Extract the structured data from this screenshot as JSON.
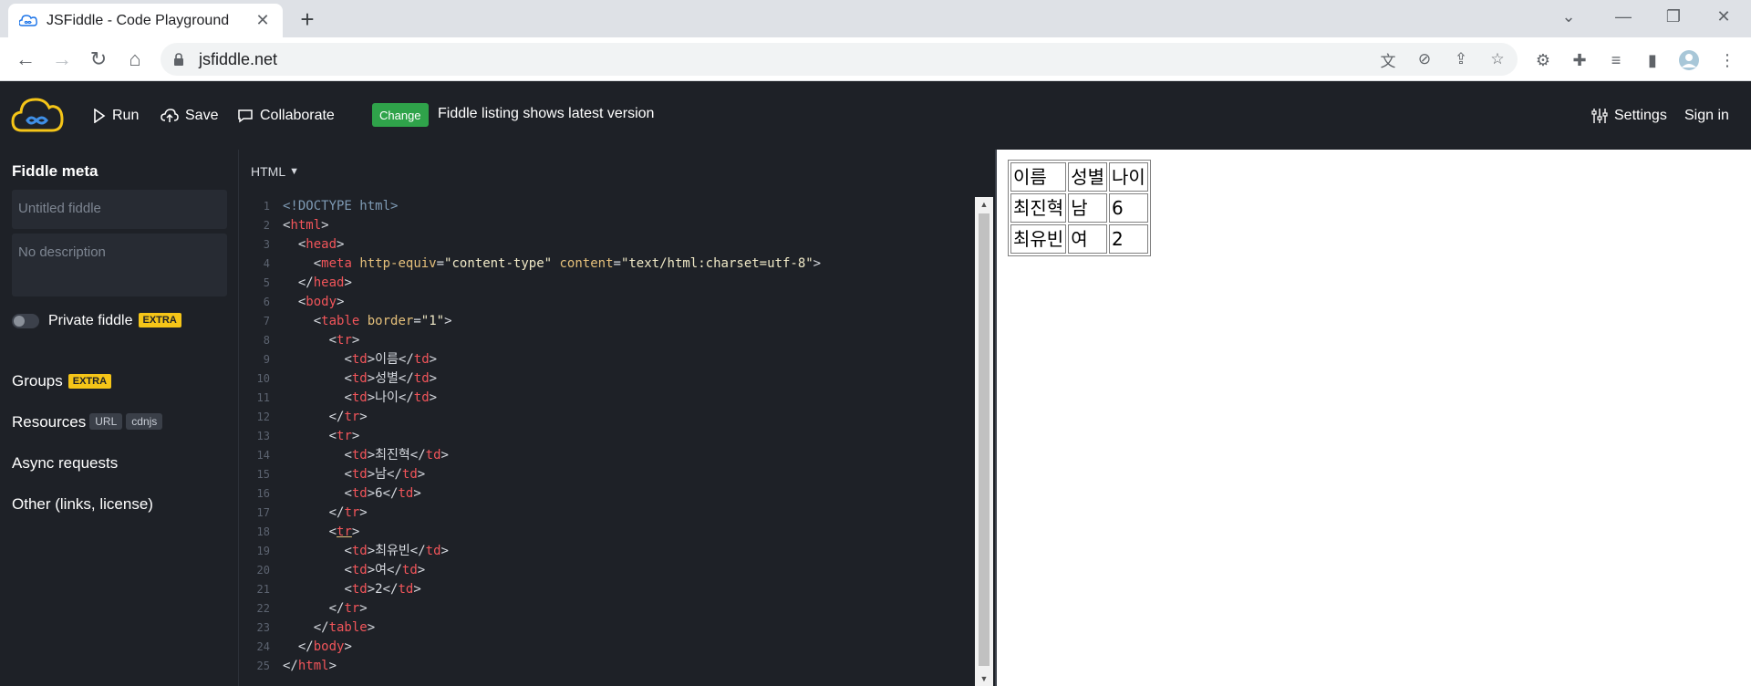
{
  "browser": {
    "tab_title": "JSFiddle - Code Playground",
    "url": "jsfiddle.net"
  },
  "header": {
    "run_label": "Run",
    "save_label": "Save",
    "collaborate_label": "Collaborate",
    "change_badge": "Change",
    "listing_text": "Fiddle listing shows latest version",
    "settings_label": "Settings",
    "signin_label": "Sign in"
  },
  "sidebar": {
    "title": "Fiddle meta",
    "name_placeholder": "Untitled fiddle",
    "description_placeholder": "No description",
    "private_label": "Private fiddle",
    "extra_badge": "EXTRA",
    "groups_label": "Groups",
    "resources_label": "Resources",
    "resource_chips": [
      "URL",
      "cdnjs"
    ],
    "async_label": "Async requests",
    "other_label": "Other (links, license)"
  },
  "editor": {
    "language": "HTML",
    "line_numbers": [
      "1",
      "2",
      "3",
      "4",
      "5",
      "6",
      "7",
      "8",
      "9",
      "10",
      "11",
      "12",
      "13",
      "14",
      "15",
      "16",
      "17",
      "18",
      "19",
      "20",
      "21",
      "22",
      "23",
      "24",
      "25"
    ]
  },
  "result_table": {
    "rows": [
      [
        "이름",
        "성별",
        "나이"
      ],
      [
        "최진혁",
        "남",
        "6"
      ],
      [
        "최유빈",
        "여",
        "2"
      ]
    ]
  },
  "colors": {
    "header_bg": "#1e2127",
    "change_green": "#2fa34a",
    "extra_yellow": "#f5c518",
    "code_tag": "#f2555a",
    "code_attr": "#e5c07b"
  }
}
